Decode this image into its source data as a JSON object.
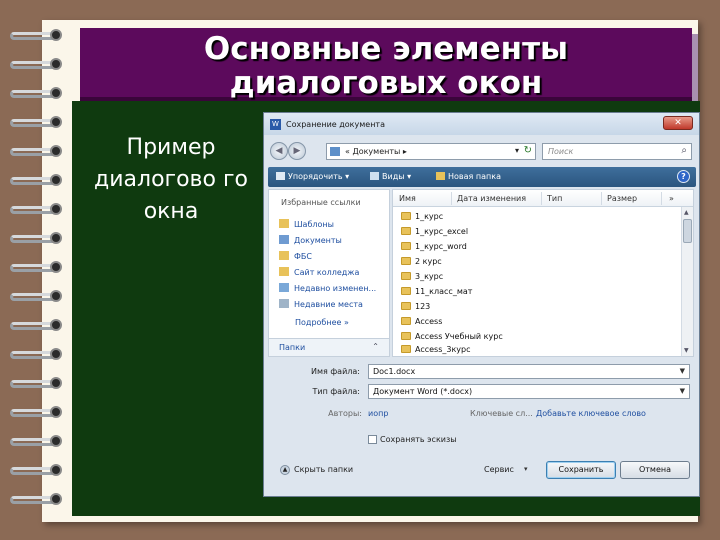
{
  "slide": {
    "title_line1": "Основные элементы",
    "title_line2": "диалоговых окон",
    "left_text": "Пример диалогово го окна"
  },
  "dialog": {
    "title": "Сохранение документа",
    "close_glyph": "✕",
    "app_icon_glyph": "W",
    "address": {
      "prefix": "«",
      "path": "Документы",
      "arrow": "▸",
      "drop": "▾",
      "refresh": "↻"
    },
    "search": {
      "placeholder": "Поиск",
      "icon": "search-icon"
    },
    "toolbar": {
      "organize": "Упорядочить ▾",
      "views": "Виды ▾",
      "new_folder": "Новая папка",
      "help": "?"
    },
    "nav": {
      "header": "Избранные ссылки",
      "items": [
        "Шаблоны",
        "Документы",
        "ФБС",
        "Сайт колледжа",
        "Недавно изменен...",
        "Недавние места"
      ],
      "more": "Подробнее  »",
      "folders": "Папки",
      "folders_chevron": "⌃"
    },
    "columns": [
      "Имя",
      "Дата изменения",
      "Тип",
      "Размер",
      "»"
    ],
    "files": [
      "1_курс",
      "1_курс_excel",
      "1_курс_word",
      "2 курс",
      "3_курс",
      "11_класс_мат",
      "123",
      "Access",
      "Access Учебный курс",
      "Access_3курс"
    ],
    "form": {
      "filename_label": "Имя файла:",
      "filename_value": "Doc1.docx",
      "filetype_label": "Тип файла:",
      "filetype_value": "Документ Word (*.docx)",
      "authors_label": "Авторы:",
      "authors_value": "иопр",
      "tags_label": "Ключевые сл...",
      "tags_value": "Добавьте ключевое слово",
      "thumbnails_label": "Сохранять эскизы",
      "hide_folders": "Скрыть папки",
      "service": "Сервис",
      "service_drop": "▾",
      "save": "Сохранить",
      "cancel": "Отмена"
    }
  },
  "colors": {
    "title_bg": "#5c0a5c",
    "board_bg": "#0f3a0f",
    "page_bg": "#fbf6ea",
    "toolbar_bg": "#2b557f",
    "background": "#8b6a55"
  }
}
